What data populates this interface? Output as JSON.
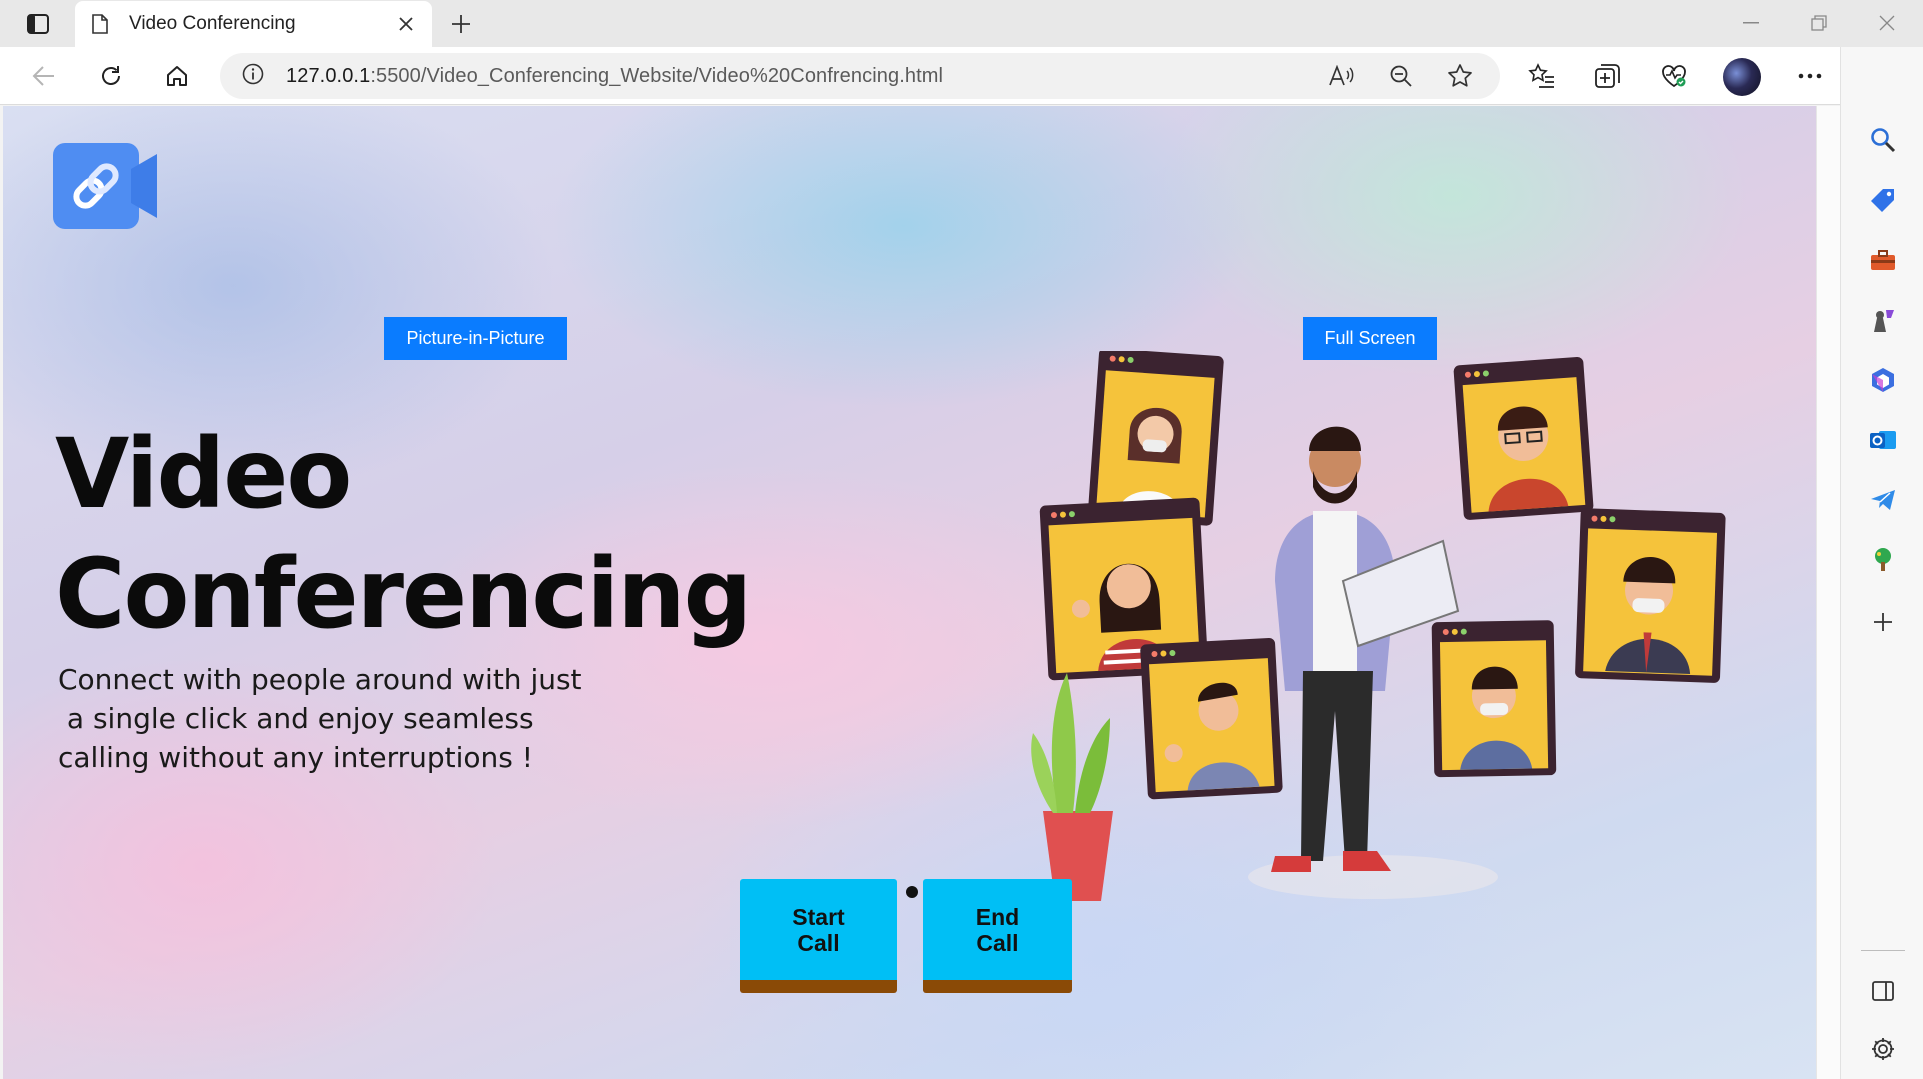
{
  "browser": {
    "tab_title": "Video Conferencing",
    "url_host": "127.0.0.1",
    "url_path": ":5500/Video_Conferencing_Website/Video%20Confrencing.html"
  },
  "page": {
    "pip_label": "Picture-in-Picture",
    "fullscreen_label": "Full Screen",
    "headline_line1": "Video",
    "headline_line2": "Conferencing",
    "subtext_lines": [
      "Connect with people around with just",
      " a single click and enjoy seamless",
      "calling without any interruptions !"
    ],
    "start_call_label": "Start\nCall",
    "end_call_label": "End\nCall"
  },
  "colors": {
    "button_blue": "#0a7cff",
    "call_button_cyan": "#00bff5",
    "call_button_shadow": "#8a4a06",
    "logo_blue": "#4f8df2"
  },
  "icons": {
    "toolbar": [
      "back-icon",
      "refresh-icon",
      "home-icon",
      "info-icon",
      "read-aloud-icon",
      "zoom-out-icon",
      "favorite-star-icon",
      "favorites-list-icon",
      "collections-icon",
      "browser-essentials-icon",
      "profile-avatar",
      "more-icon",
      "bing-copilot-icon"
    ],
    "sidebar": [
      "search-icon",
      "shopping-tag-icon",
      "tools-icon",
      "games-icon",
      "microsoft-365-icon",
      "outlook-icon",
      "telegram-icon",
      "tree-icon",
      "add-icon",
      "split-screen-icon",
      "settings-icon"
    ]
  }
}
